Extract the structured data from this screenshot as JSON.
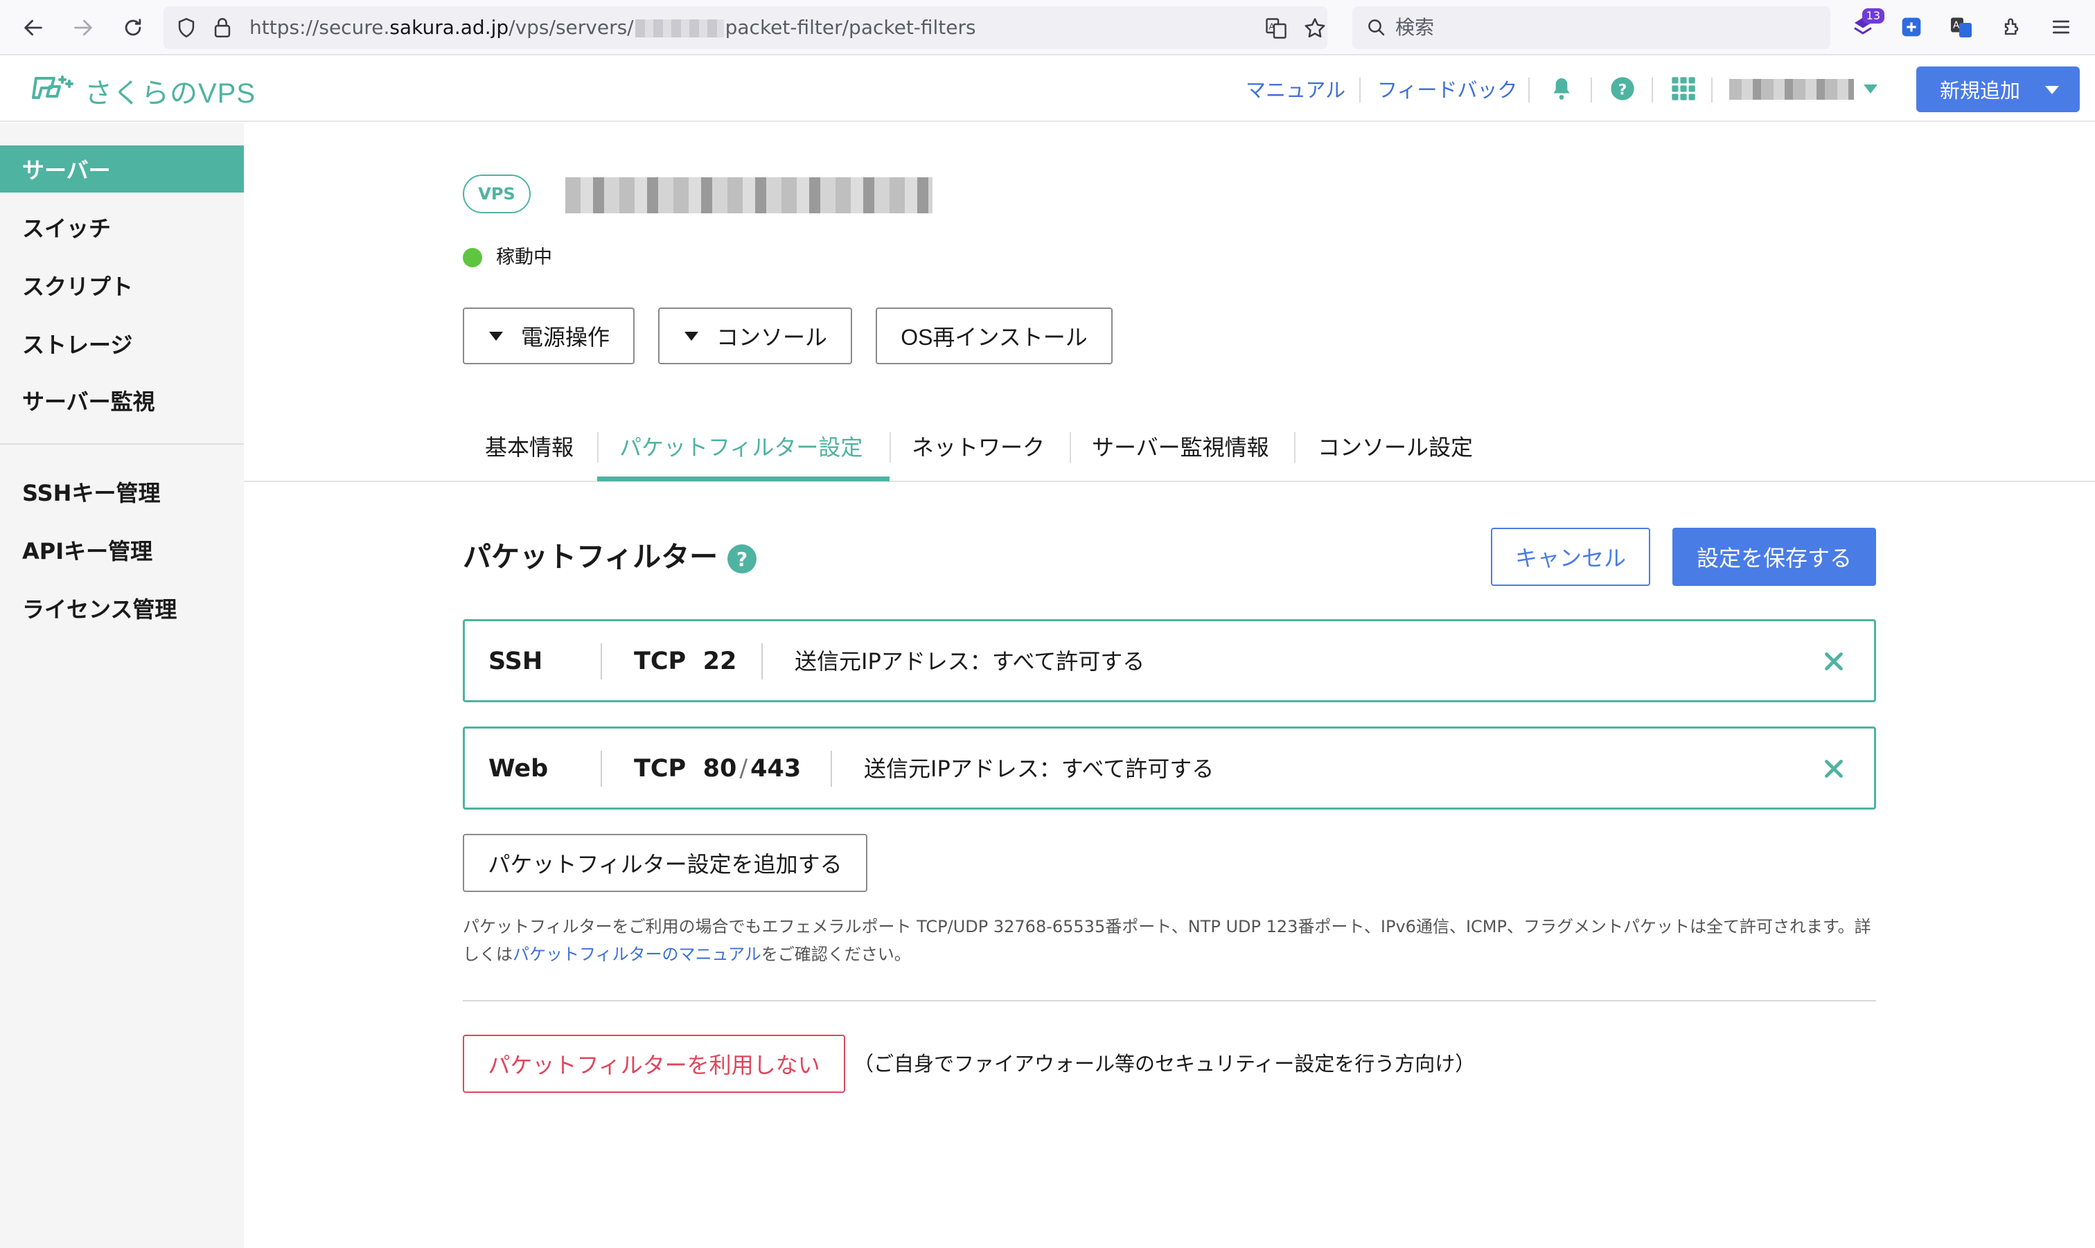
{
  "browser": {
    "url_prefix": "https://secure.",
    "url_host": "sakura.ad.jp",
    "url_path_before": "/vps/servers/",
    "url_path_after": "packet-filter/packet-filters",
    "search_placeholder": "検索",
    "extension_badge": "13"
  },
  "header": {
    "logo_text": "さくらのVPS",
    "links": [
      "マニュアル",
      "フィードバック"
    ],
    "new_button": "新規追加",
    "accent_color": "#4eb3a1",
    "primary_color": "#4a7ce6"
  },
  "sidebar": {
    "items": [
      "サーバー",
      "スイッチ",
      "スクリプト",
      "ストレージ",
      "サーバー監視"
    ],
    "items2": [
      "SSHキー管理",
      "APIキー管理",
      "ライセンス管理"
    ]
  },
  "server": {
    "badge": "VPS",
    "status": "稼動中",
    "status_color": "#5ec540",
    "buttons": [
      "電源操作",
      "コンソール",
      "OS再インストール"
    ]
  },
  "tabs": [
    "基本情報",
    "パケットフィルター設定",
    "ネットワーク",
    "サーバー監視情報",
    "コンソール設定"
  ],
  "active_tab": "パケットフィルター設定",
  "packet_filter": {
    "title": "パケットフィルター",
    "help": "?",
    "cancel": "キャンセル",
    "save": "設定を保存する",
    "rules": [
      {
        "name": "SSH",
        "protocol": "TCP",
        "ports": [
          "22"
        ],
        "source": "送信元IPアドレス：すべて許可する"
      },
      {
        "name": "Web",
        "protocol": "TCP",
        "ports": [
          "80",
          "443"
        ],
        "source": "送信元IPアドレス：すべて許可する"
      }
    ],
    "port_separator": "/",
    "add_button": "パケットフィルター設定を追加する",
    "note_text": "パケットフィルターをご利用の場合でもエフェメラルポート TCP/UDP 32768-65535番ポート、NTP UDP 123番ポート、IPv6通信、ICMP、フラグメントパケットは全て許可されます。詳しくは",
    "note_link": "パケットフィルターのマニュアル",
    "note_suffix": "をご確認ください。",
    "disable_button": "パケットフィルターを利用しない",
    "disable_note": "（ご自身でファイアウォール等のセキュリティー設定を行う方向け）",
    "danger_color": "#e0455c"
  }
}
